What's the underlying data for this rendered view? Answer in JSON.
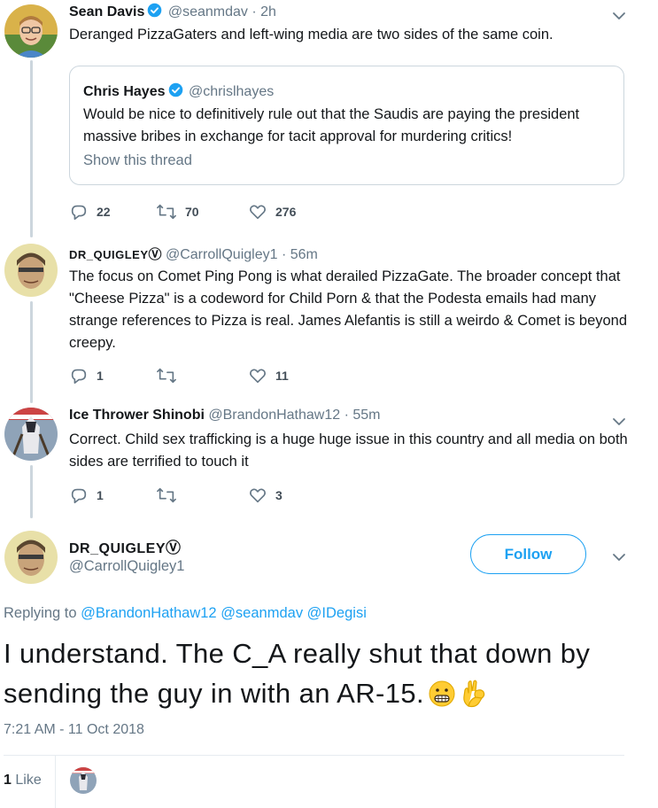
{
  "tweets": [
    {
      "name": "Sean Davis",
      "handle": "@seanmdav",
      "time": "2h",
      "text": "Deranged PizzaGaters and left-wing media are two sides of the same coin.",
      "quote": {
        "name": "Chris Hayes",
        "handle": "@chrislhayes",
        "text": "Would be nice to definitively rule out that the Saudis are paying the president massive bribes in exchange for tacit approval for murdering critics!",
        "show_thread": "Show this thread"
      },
      "replies": "22",
      "retweets": "70",
      "likes": "276"
    },
    {
      "name": "DR_QUIGLEY",
      "name_suffix": "Ⓥ",
      "handle": "@CarrollQuigley1",
      "time": "56m",
      "text": "The focus on Comet Ping Pong is what derailed PizzaGate. The broader concept that \"Cheese Pizza\" is a codeword for Child Porn & that the Podesta emails had many strange references to Pizza is real. James Alefantis is still a weirdo & Comet is beyond creepy.",
      "replies": "1",
      "retweets": "",
      "likes": "11"
    },
    {
      "name": "Ice Thrower Shinobi",
      "handle": "@BrandonHathaw12",
      "time": "55m",
      "text": "Correct. Child sex trafficking is a huge huge issue in this country and all media on both sides are terrified to touch it",
      "replies": "1",
      "retweets": "",
      "likes": "3"
    }
  ],
  "main_tweet": {
    "name": "DR_QUIGLEY",
    "name_suffix": "Ⓥ",
    "handle": "@CarrollQuigley1",
    "follow_label": "Follow",
    "replying_prefix": "Replying to",
    "replying_to": [
      "@BrandonHathaw12",
      "@seanmdav",
      "@IDegisi"
    ],
    "text": "I understand. The C_A really shut that down by sending the guy in with an AR-15.",
    "emojis": [
      "grimacing-face",
      "ok-hand"
    ],
    "timestamp": "7:21 AM - 11 Oct 2018",
    "like_count": "1",
    "like_label": "Like"
  },
  "colors": {
    "accent": "#1da1f2",
    "secondary_text": "#657786",
    "border": "#ccd6dd",
    "thread_line": "#ccd6dd"
  },
  "icons": {
    "verified": "verified-badge-icon",
    "reply": "reply-icon",
    "retweet": "retweet-icon",
    "like": "heart-icon",
    "caret": "chevron-down-icon"
  }
}
